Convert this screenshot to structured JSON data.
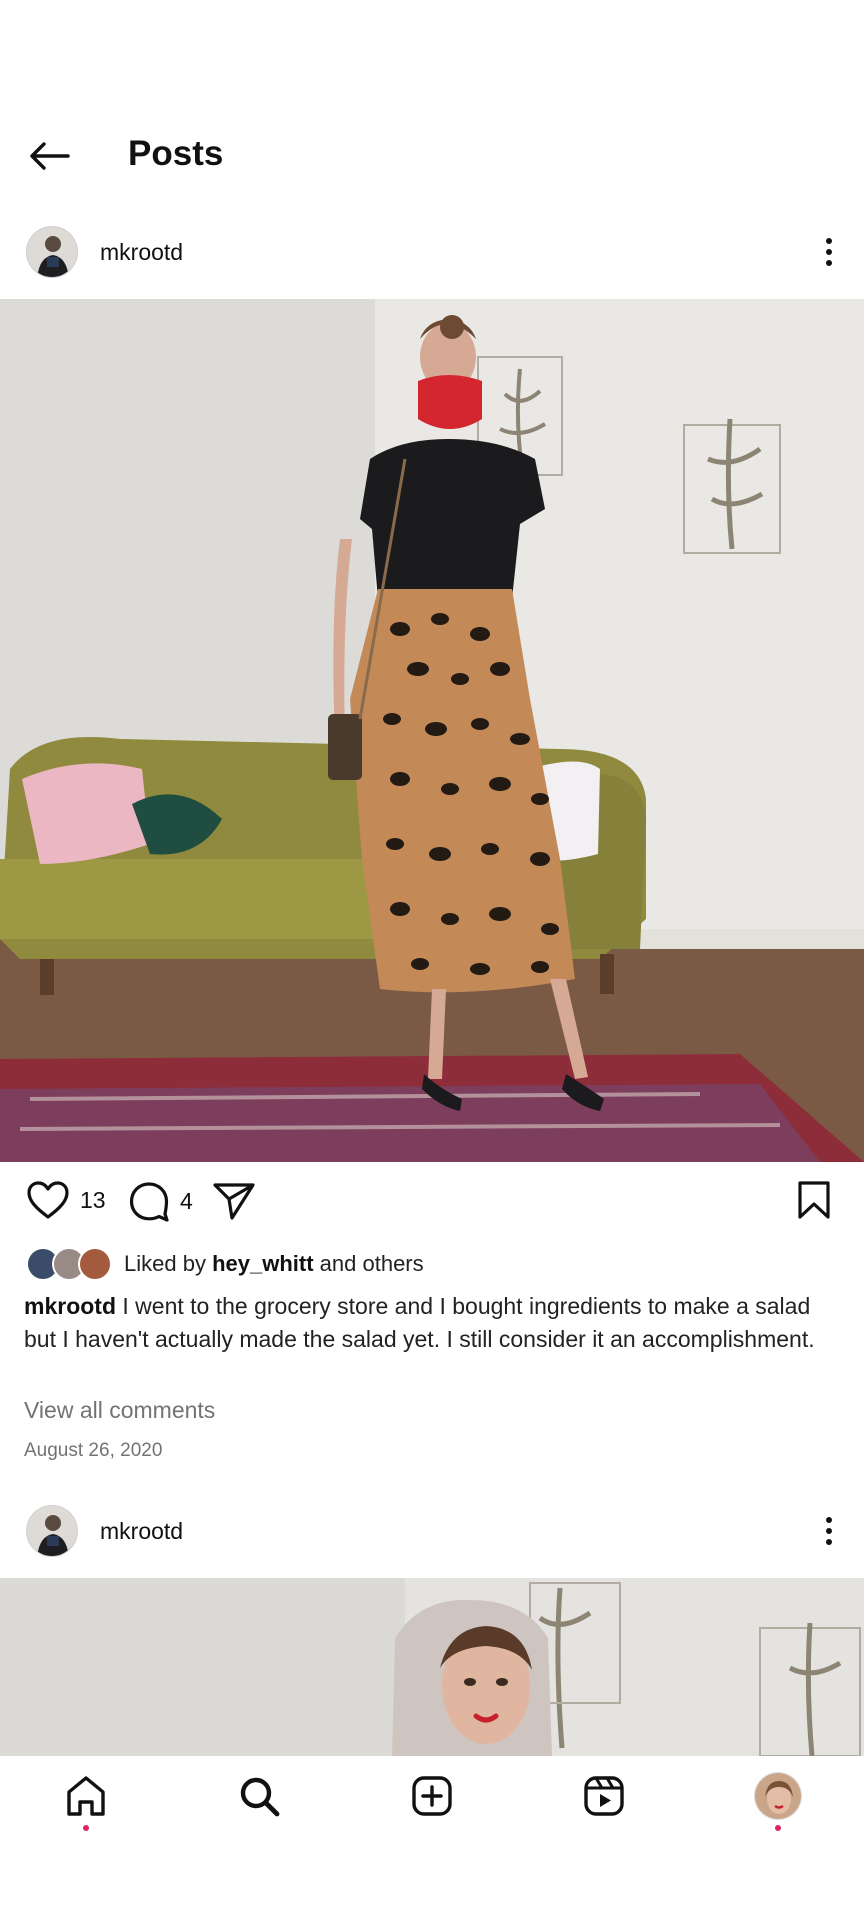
{
  "header": {
    "title": "Posts"
  },
  "posts": [
    {
      "username": "mkrootd",
      "likes_count": "13",
      "comments_count": "4",
      "liked_by_prefix": "Liked by",
      "liked_by_user": "hey_whitt",
      "liked_by_suffix": "and others",
      "caption_user": "mkrootd",
      "caption_text": "I went to the grocery store and I bought ingredients to make a salad but I haven't actually made the salad yet. I still consider it an accomplishment.",
      "view_all_comments": "View all comments",
      "date": "August 26, 2020"
    },
    {
      "username": "mkrootd"
    }
  ],
  "bottom_nav": {
    "items": [
      {
        "icon": "home-icon",
        "notification_dot": true
      },
      {
        "icon": "search-icon",
        "notification_dot": false
      },
      {
        "icon": "create-icon",
        "notification_dot": false
      },
      {
        "icon": "reels-icon",
        "notification_dot": false
      },
      {
        "icon": "profile-icon",
        "notification_dot": true
      }
    ]
  },
  "colors": {
    "text": "#111111",
    "secondary_text": "#737373",
    "notification": "#e0245e",
    "background": "#ffffff"
  }
}
